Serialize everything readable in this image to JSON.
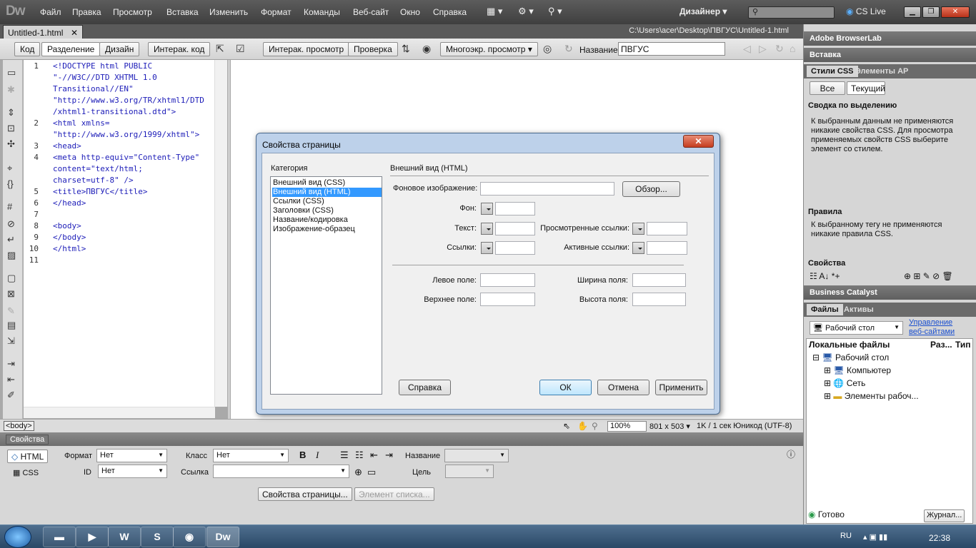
{
  "app": {
    "logo": "Dw",
    "workspace": "Дизайнер",
    "cslive": "CS Live"
  },
  "menu": [
    "Файл",
    "Правка",
    "Просмотр",
    "Вставка",
    "Изменить",
    "Формат",
    "Команды",
    "Веб-сайт",
    "Окно",
    "Справка"
  ],
  "window_controls": {
    "minimize": "▁",
    "maximize": "❐",
    "close": "✕"
  },
  "document": {
    "tab": "Untitled-1.html",
    "tab_close": "✕",
    "path": "C:\\Users\\acer\\Desktop\\ПВГУС\\Untitled-1.html"
  },
  "toolbar": {
    "code": "Код",
    "split": "Разделение",
    "design": "Дизайн",
    "live_code": "Интерак. код",
    "live_view": "Интерак. просмотр",
    "inspect": "Проверка",
    "multiscreen": "Многоэкр. просмотр",
    "title_label": "Название:",
    "title_value": "ПВГУС"
  },
  "code": {
    "line_numbers": [
      "1",
      "2",
      "3",
      "4",
      "5",
      "6",
      "7",
      "8",
      "9",
      "10",
      "11"
    ],
    "lines": [
      "<!DOCTYPE html PUBLIC",
      "\"-//W3C//DTD XHTML 1.0",
      "Transitional//EN\"",
      "\"http://www.w3.org/TR/xhtml1/DTD",
      "/xhtml1-transitional.dtd\">",
      "<html xmlns=",
      "\"http://www.w3.org/1999/xhtml\">",
      "<head>",
      "<meta http-equiv=\"Content-Type\"",
      "content=\"text/html;",
      "charset=utf-8\" />",
      "<title>ПВГУС</title>",
      "</head>",
      "",
      "<body>",
      "</body>",
      "</html>"
    ]
  },
  "status": {
    "tag": "<body>",
    "zoom": "100%",
    "size": "801 x 503",
    "info": "1K / 1 сек  Юникод (UTF-8)"
  },
  "properties": {
    "header": "Свойства",
    "html": "HTML",
    "css": "CSS",
    "format_label": "Формат",
    "format_value": "Нет",
    "id_label": "ID",
    "id_value": "Нет",
    "class_label": "Класс",
    "class_value": "Нет",
    "link_label": "Ссылка",
    "name_label": "Название",
    "target_label": "Цель",
    "page_props": "Свойства страницы...",
    "list_item": "Элемент списка..."
  },
  "right": {
    "browserlab": "Adobe BrowserLab",
    "insert": "Вставка",
    "css_tab": "Стили CSS",
    "ap_tab": "Элементы AP",
    "all": "Все",
    "current": "Текущий",
    "summary_title": "Сводка по выделению",
    "summary_text": [
      "К выбранным данным не применяются",
      "никакие свойства CSS.  Для просмотра",
      "применяемых свойств CSS выберите",
      "элемент со стилем."
    ],
    "rules_title": "Правила",
    "rules_text": [
      "К выбранному тегу не применяются",
      "никакие правила CSS."
    ],
    "props_title": "Свойства",
    "bc": "Business Catalyst",
    "files_tab": "Файлы",
    "assets_tab": "Активы",
    "site_select": "Рабочий стол",
    "manage": [
      "Управление",
      "веб-сайтами"
    ],
    "col_local": "Локальные файлы",
    "col_size": "Раз...",
    "col_type": "Тип",
    "tree": [
      "Рабочий стол",
      "Компьютер",
      "Сеть",
      "Элементы рабоч..."
    ],
    "ready": "Готово",
    "log": "Журнал..."
  },
  "dialog": {
    "title": "Свойства страницы",
    "close": "✕",
    "category_label": "Категория",
    "categories": [
      "Внешний вид (CSS)",
      "Внешний вид (HTML)",
      "Ссылки (CSS)",
      "Заголовки (CSS)",
      "Название/кодировка",
      "Изображение-образец"
    ],
    "section": "Внешний вид (HTML)",
    "bg_image": "Фоновое изображение:",
    "browse": "Обзор...",
    "bg": "Фон:",
    "text": "Текст:",
    "links": "Ссылки:",
    "visited": "Просмотренные ссылки:",
    "active": "Активные ссылки:",
    "left_margin": "Левое поле:",
    "top_margin": "Верхнее поле:",
    "margin_width": "Ширина поля:",
    "margin_height": "Высота поля:",
    "help": "Справка",
    "ok": "ОК",
    "cancel": "Отмена",
    "apply": "Применить"
  },
  "taskbar": {
    "lang": "RU",
    "time": "22:38",
    "dw": "Dw"
  }
}
